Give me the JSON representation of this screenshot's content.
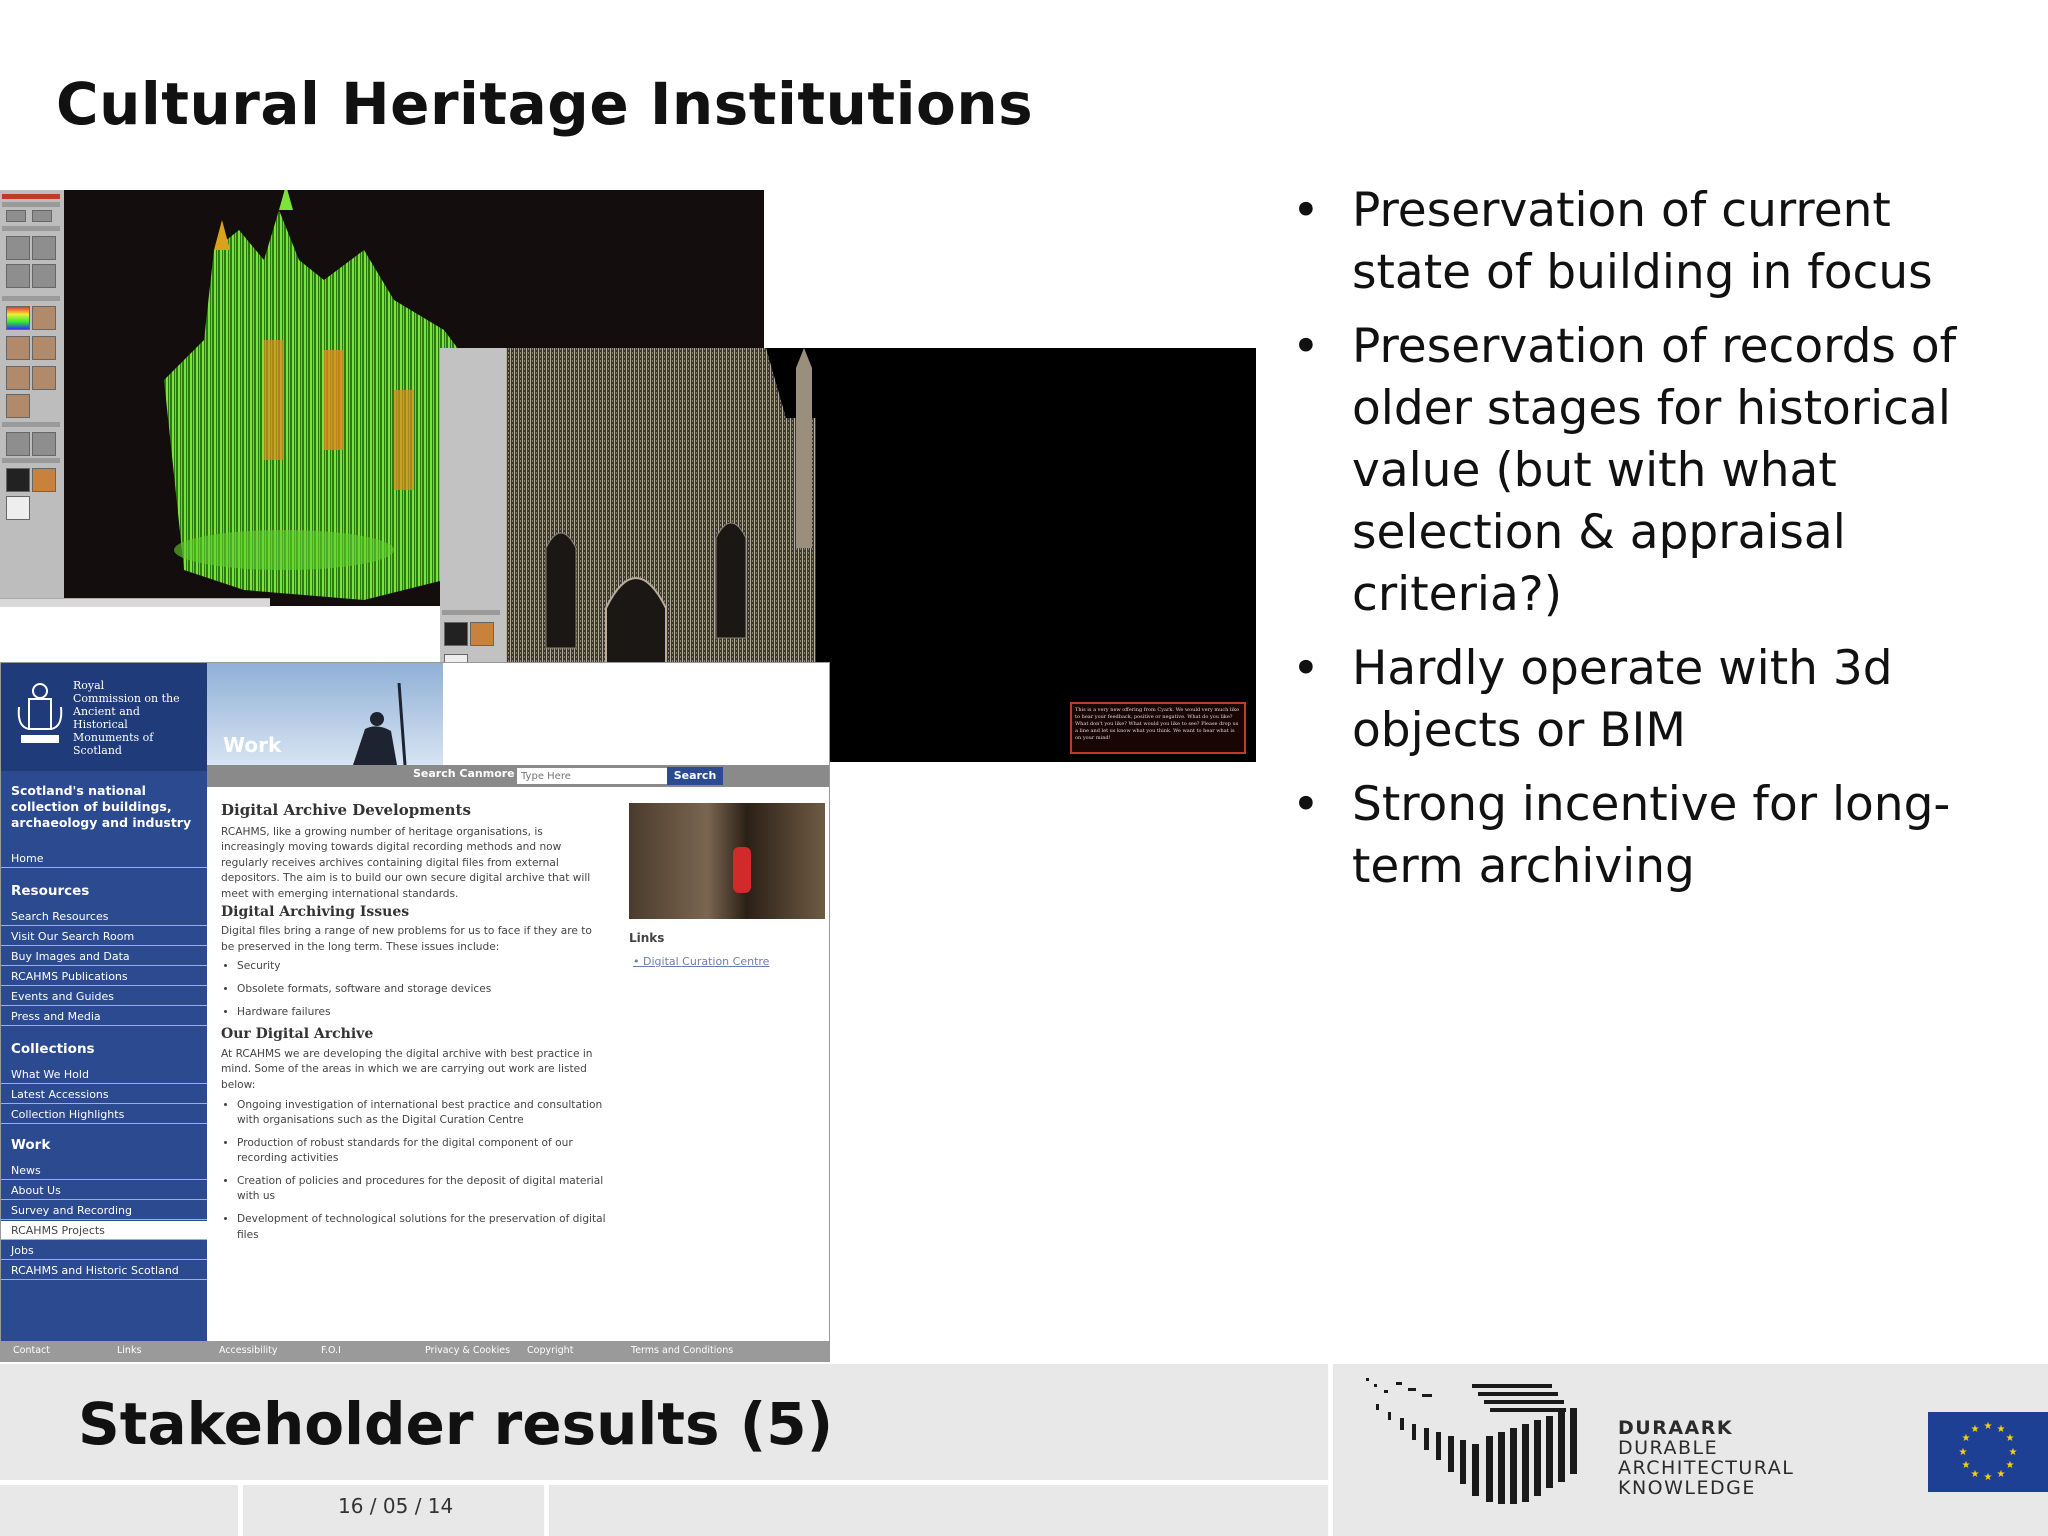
{
  "slide": {
    "title": "Cultural Heritage Institutions",
    "bullets": [
      "Preservation of current state of building in focus",
      "Preservation of records of older stages for historical value (but with what selection & appraisal criteria?)",
      "Hardly operate with 3d objects or BIM",
      "Strong incentive for long-term archiving"
    ]
  },
  "viewer2": {
    "feedback_text": "This is a very new offering from Cyark. We would very much like to hear your feedback, positive or negative. What do you like? What don't you like? What would you like to see? Please drop us a line and let us know what you think. We want to hear what is on your mind!"
  },
  "website": {
    "logo_lines": [
      "Royal",
      "Commission on the",
      "Ancient and",
      "Historical",
      "Monuments of",
      "Scotland"
    ],
    "tagline": "Scotland's national collection of buildings, archaeology and industry",
    "banner_word": "Work",
    "search": {
      "label": "Search Canmore",
      "placeholder": "Type Here",
      "button": "Search"
    },
    "nav": {
      "home": "Home",
      "resources_heading": "Resources",
      "resources": [
        "Search Resources",
        "Visit Our Search Room",
        "Buy Images and Data",
        "RCAHMS Publications",
        "Events and Guides",
        "Press and Media"
      ],
      "collections_heading": "Collections",
      "collections": [
        "What We Hold",
        "Latest Accessions",
        "Collection Highlights"
      ],
      "work_heading": "Work",
      "work": [
        "News",
        "About Us",
        "Survey and Recording",
        "RCAHMS Projects",
        "Jobs",
        "RCAHMS and Historic Scotland"
      ]
    },
    "content": {
      "heading": "Digital Archive Developments",
      "intro": "RCAHMS, like a growing number of heritage organisations, is increasingly moving towards digital recording methods and now regularly receives archives containing digital files from external depositors. The aim is to build our own secure digital archive that will meet with emerging international standards.",
      "issues_heading": "Digital Archiving Issues",
      "issues_intro": "Digital files bring a range of new problems for us to face if they are to be preserved in the long term. These issues include:",
      "issues": [
        "Security",
        "Obsolete formats, software and storage devices",
        "Hardware failures"
      ],
      "archive_heading": "Our Digital Archive",
      "archive_intro": "At RCAHMS we are developing the digital archive with best practice in mind. Some of the areas in which we are carrying out work are listed below:",
      "archive_items": [
        "Ongoing investigation of international best practice and consultation with organisations such as the Digital Curation Centre",
        "Production of robust standards for the digital component of our recording activities",
        "Creation of policies and procedures for the deposit of digital material with us",
        "Development of technological solutions for the preservation of digital files"
      ]
    },
    "links_heading": "Links",
    "links": [
      "Digital Curation Centre"
    ],
    "footer_links": [
      "Contact",
      "Links",
      "Accessibility",
      "F.O.I",
      "Privacy & Cookies",
      "Copyright",
      "Terms and Conditions"
    ]
  },
  "footer": {
    "title": "Stakeholder results (5)",
    "date": "16 / 05 / 14",
    "logo_lines": [
      "DURAARK",
      "DURABLE",
      "ARCHITECTURAL",
      "KNOWLEDGE"
    ]
  },
  "colors": {
    "site_nav_blue": "#2b4a8f",
    "eu_blue": "#1d3f94",
    "eu_star": "#f5d400",
    "point_cloud_green": "#5fd12a",
    "point_cloud_orange": "#e08a1e",
    "footer_band": "#e8e8e8"
  }
}
